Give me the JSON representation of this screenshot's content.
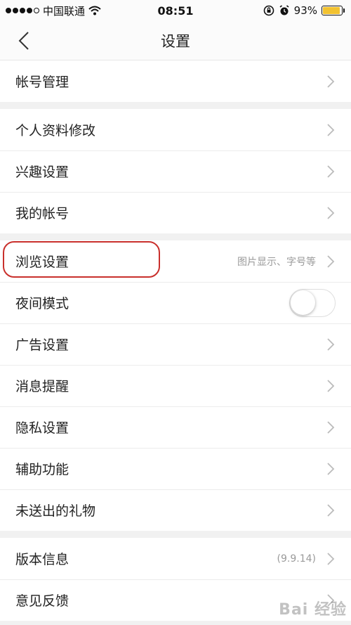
{
  "status": {
    "carrier": "中国联通",
    "time": "08:51",
    "battery": "93%",
    "battery_level": 0.93
  },
  "nav": {
    "title": "设置"
  },
  "group1": [
    {
      "label": "帐号管理"
    }
  ],
  "group2": [
    {
      "label": "个人资料修改"
    },
    {
      "label": "兴趣设置"
    },
    {
      "label": "我的帐号"
    }
  ],
  "group3": [
    {
      "label": "浏览设置",
      "hint": "图片显示、字号等"
    },
    {
      "label": "夜间模式"
    },
    {
      "label": "广告设置"
    },
    {
      "label": "消息提醒"
    },
    {
      "label": "隐私设置"
    },
    {
      "label": "辅助功能"
    },
    {
      "label": "未送出的礼物"
    }
  ],
  "group4": [
    {
      "label": "版本信息",
      "hint": "(9.9.14)"
    },
    {
      "label": "意见反馈"
    }
  ],
  "watermark": "Bai 经验"
}
